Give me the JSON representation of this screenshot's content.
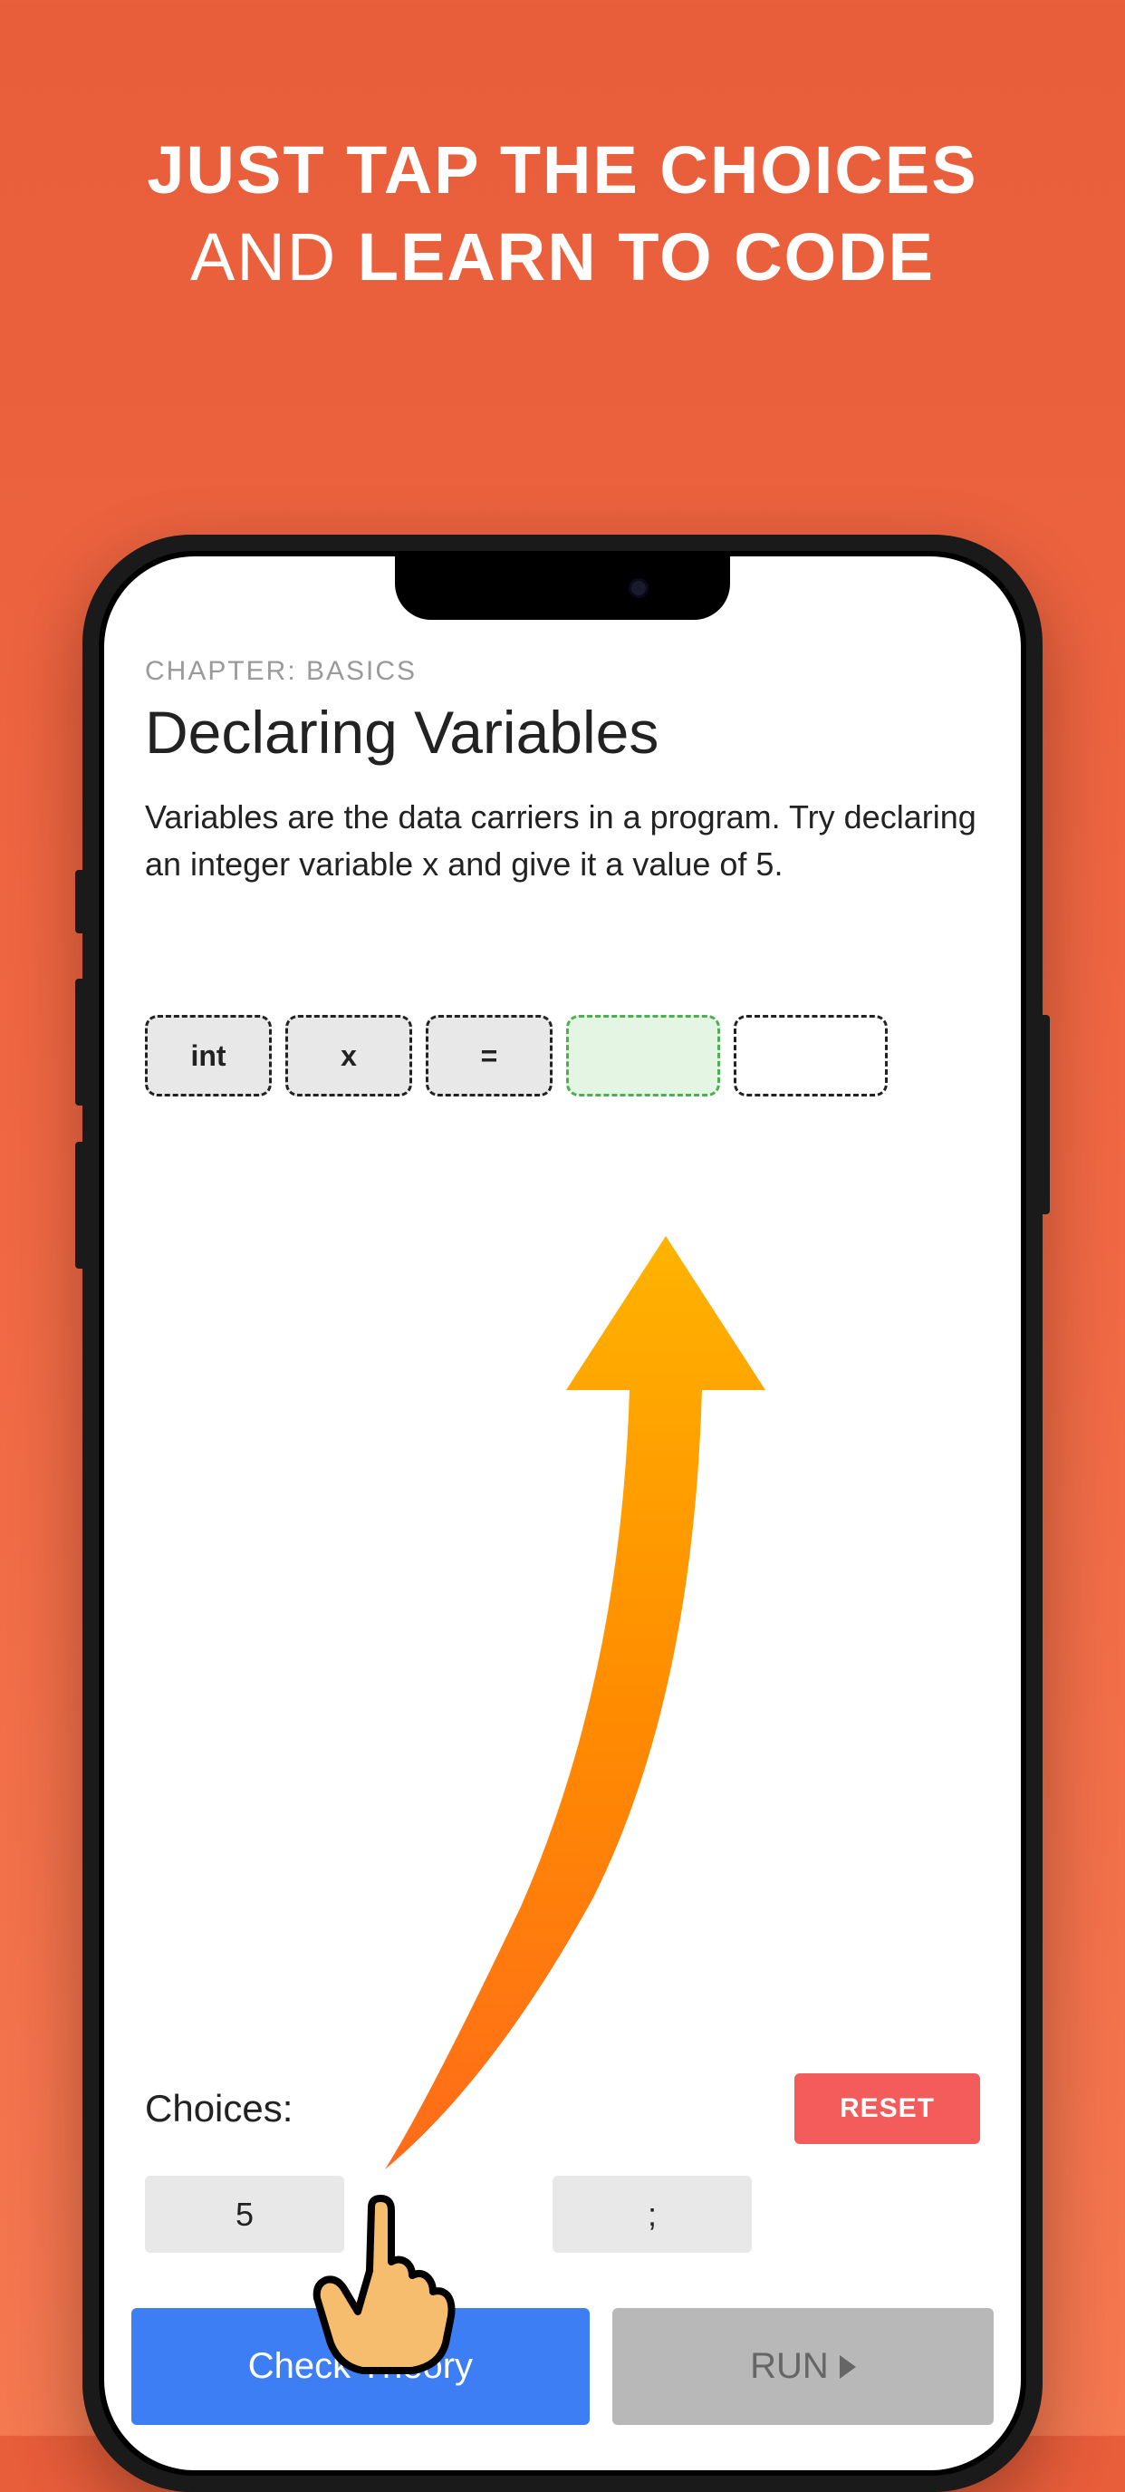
{
  "promo": {
    "line1": "JUST TAP THE CHOICES",
    "line2_normal": "AND ",
    "line2_bold": "LEARN TO CODE"
  },
  "app": {
    "chapter_label": "CHAPTER: BASICS",
    "lesson_title": "Declaring Variables",
    "lesson_description": "Variables are the data carriers in a program. Try declaring an integer variable x and give it a value of 5.",
    "code_slots": [
      {
        "value": "int",
        "state": "filled"
      },
      {
        "value": "x",
        "state": "filled"
      },
      {
        "value": "=",
        "state": "filled"
      },
      {
        "value": "",
        "state": "active"
      },
      {
        "value": "",
        "state": "empty"
      }
    ],
    "choices_label": "Choices:",
    "reset_label": "RESET",
    "choices": [
      {
        "label": "5"
      },
      {
        "label": ";"
      }
    ],
    "check_theory_label": "Check Theory",
    "run_label": "RUN"
  }
}
